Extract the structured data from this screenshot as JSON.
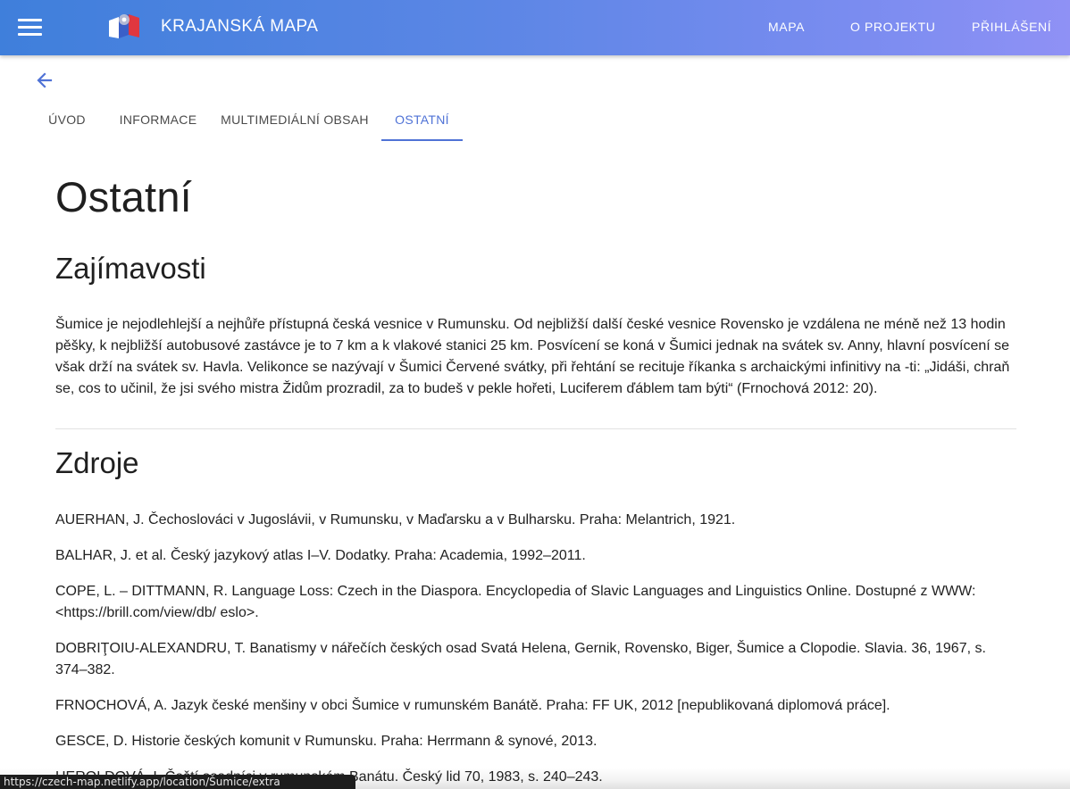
{
  "appbar": {
    "brand": "KRAJANSKÁ MAPA",
    "nav": [
      "MAPA",
      "O PROJEKTU",
      "PŘIHLÁŠENÍ"
    ],
    "menu_icon": "menu-icon",
    "logo_icon": "czech-map-logo"
  },
  "back_icon": "arrow-back-icon",
  "tabs": {
    "items": [
      "ÚVOD",
      "INFORMACE",
      "MULTIMEDIÁLNÍ OBSAH",
      "OSTATNÍ"
    ],
    "active": "OSTATNÍ"
  },
  "page": {
    "title": "Ostatní",
    "sections": {
      "facts": {
        "heading": "Zajímavosti",
        "text": "Šumice je nejodlehlejší a nejhůře přístupná česká vesnice v Rumunsku. Od nejbližší další české vesnice Rovensko je vzdálena ne méně než 13 hodin pěšky, k nejbližší autobusové zastávce je to 7 km a k vlakové stanici 25 km. Posvícení se koná v Šumici jednak na svátek sv. Anny, hlavní posvícení se však drží na svátek sv. Havla. Velikonce se nazývají v Šumici Červené svátky, při řehtání se recituje říkanka s archaickými infinitivy na -ti: „Jidáši, chraň se, cos to učinil, že jsi svého mistra Židům prozradil, za to budeš v pekle hořeti, Luciferem ďáblem tam býti“ (Frnochová 2012: 20)."
      },
      "sources": {
        "heading": "Zdroje",
        "refs": [
          "AUERHAN, J. Čechoslováci v Jugoslávii, v Rumunsku, v Maďarsku a v Bulharsku. Praha: Melantrich, 1921.",
          "BALHAR, J. et al. Český jazykový atlas I–V. Dodatky. Praha: Academia, 1992–2011.",
          "COPE, L. – DITTMANN, R. Language Loss: Czech in the Diaspora. Encyclopedia of Slavic Languages and Linguistics Online. Dostupné z WWW: <https://brill.com/view/db/ eslo>.",
          "DOBRIŢOIU-ALEXANDRU, T. Banatismy v nářečích českých osad Svatá Helena, Gernik, Rovensko, Biger, Šumice a Clopodie. Slavia. 36, 1967, s. 374–382.",
          "FRNOCHOVÁ, A. Jazyk české menšiny v obci Šumice v rumunském Banátě. Praha: FF UK, 2012 [nepublikovaná diplomová práce].",
          "GESCE, D. Historie českých komunit v Rumunsku. Praha: Herrmann & synové, 2013.",
          "HEROLDOVÁ, I. Čeští osadníci v rumunském Banátu. Český lid 70, 1983, s. 240–243."
        ]
      }
    }
  },
  "status_bar": {
    "url": "https://czech-map.netlify.app/location/Šumice/extra"
  },
  "colors": {
    "accent": "#4f72d6",
    "appbar_start": "#3f7fdb",
    "appbar_end": "#8f91f5"
  }
}
